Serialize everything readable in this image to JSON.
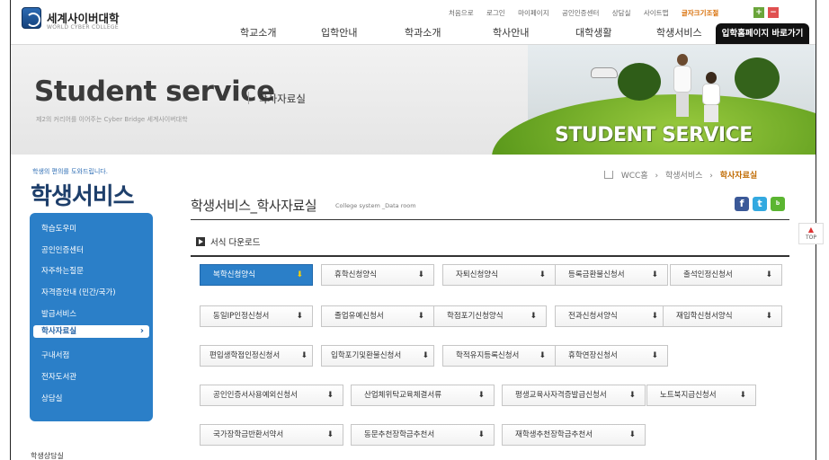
{
  "site": {
    "logo_kr": "세계사이버대학",
    "logo_en": "WORLD CYBER COLLEGE"
  },
  "util_links": [
    {
      "label": "처음으로"
    },
    {
      "label": "로그인"
    },
    {
      "label": "마이페이지"
    },
    {
      "label": "공인인증센터"
    },
    {
      "label": "상담실"
    },
    {
      "label": "사이트맵"
    },
    {
      "label": "글자크기조절"
    }
  ],
  "util_font_controls": {
    "plus": "+",
    "minus": "−"
  },
  "gnb": [
    {
      "label": "학교소개"
    },
    {
      "label": "입학안내"
    },
    {
      "label": "학과소개"
    },
    {
      "label": "학사안내"
    },
    {
      "label": "대학생활"
    },
    {
      "label": "학생서비스"
    }
  ],
  "admission_button": "입학홈페이지 바로가기",
  "visual": {
    "title": "Student service",
    "subtitle": "학사자료실",
    "tagline": "제2의 커리어를 이어주는 Cyber Bridge 세계사이버대학",
    "art_text": "STUDENT SERVICE"
  },
  "sidebar": {
    "caption": "학생의 편의를 도와드립니다.",
    "title": "학생서비스",
    "items": [
      {
        "label": "학습도우미"
      },
      {
        "label": "공인인증센터"
      },
      {
        "label": "자주하는질문"
      },
      {
        "label": "자격증안내 (민간/국가)"
      },
      {
        "label": "발급서비스"
      },
      {
        "label": "학사자료실"
      },
      {
        "label": "구내서점"
      },
      {
        "label": "전자도서관"
      },
      {
        "label": "상담실"
      }
    ],
    "bottom": "학생상담실"
  },
  "breadcrumb": {
    "items": [
      "WCC홈",
      "학생서비스",
      "학사자료실"
    ],
    "separator": "›"
  },
  "page": {
    "title": "학생서비스_학사자료실",
    "title_en": "College system _Data room"
  },
  "social": [
    {
      "label": "f",
      "icon": "facebook-icon",
      "color": "#3b5998"
    },
    {
      "label": "t",
      "icon": "twitter-icon",
      "color": "#33a9e0"
    },
    {
      "label": "b",
      "icon": "blog-icon",
      "color": "#5bb531"
    }
  ],
  "section": {
    "label": "서식 다운로드"
  },
  "download_icon": "⬇",
  "download_rows": [
    [
      "복학신청양식",
      "휴학신청양식",
      "자퇴신청양식",
      "등록금환불신청서",
      "출석인정신청서"
    ],
    [
      "동일IP인정신청서",
      "졸업유예신청서",
      "학점포기신청양식",
      "전과신청서양식",
      "재입학신청서양식"
    ],
    [
      "편입생학점인정신청서",
      "입학포기및환불신청서",
      "학적유지등록신청서",
      "휴학연장신청서"
    ],
    [
      "공인인증서사용예외신청서",
      "산업체위탁교육체결서류",
      "평생교육사자격증발급신청서",
      "노트북지급신청서"
    ],
    [
      "국가장학금반환서약서",
      "동문추천장학금추천서",
      "재학생추천장학금추천서"
    ]
  ],
  "top_button": "TOP",
  "colors": {
    "accent_blue": "#2b7fc8",
    "title_navy": "#1e3f6b",
    "highlight_orange": "#c06a00"
  }
}
